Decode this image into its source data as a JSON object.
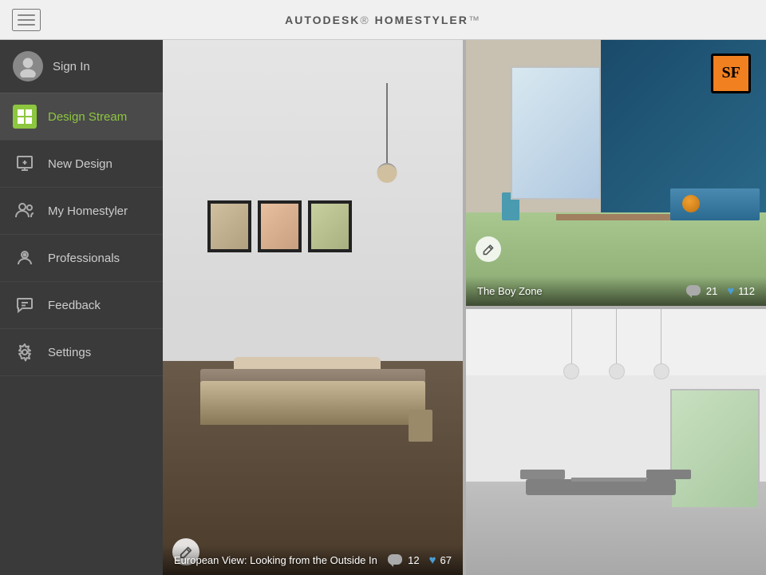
{
  "header": {
    "title_prefix": "AUTODESK",
    "title_suffix": "HOMESTYLER",
    "hamburger_label": "Menu"
  },
  "sidebar": {
    "user": {
      "label": "Sign In"
    },
    "items": [
      {
        "id": "design-stream",
        "label": "Design Stream",
        "active": true
      },
      {
        "id": "new-design",
        "label": "New Design",
        "active": false
      },
      {
        "id": "my-homestyler",
        "label": "My Homestyler",
        "active": false
      },
      {
        "id": "professionals",
        "label": "Professionals",
        "active": false
      },
      {
        "id": "feedback",
        "label": "Feedback",
        "active": false
      },
      {
        "id": "settings",
        "label": "Settings",
        "active": false
      }
    ]
  },
  "designs": {
    "left_large": {
      "title": "European View: Looking from the Outside In",
      "comments": "12",
      "likes": "67"
    },
    "top_right": {
      "title": "The Boy Zone",
      "comments": "21",
      "likes": "112",
      "sf_text": "SF"
    },
    "bottom_right": {
      "title": "",
      "comments": "",
      "likes": ""
    }
  },
  "icons": {
    "edit": "✏",
    "comment": "💬",
    "heart": "♥"
  }
}
